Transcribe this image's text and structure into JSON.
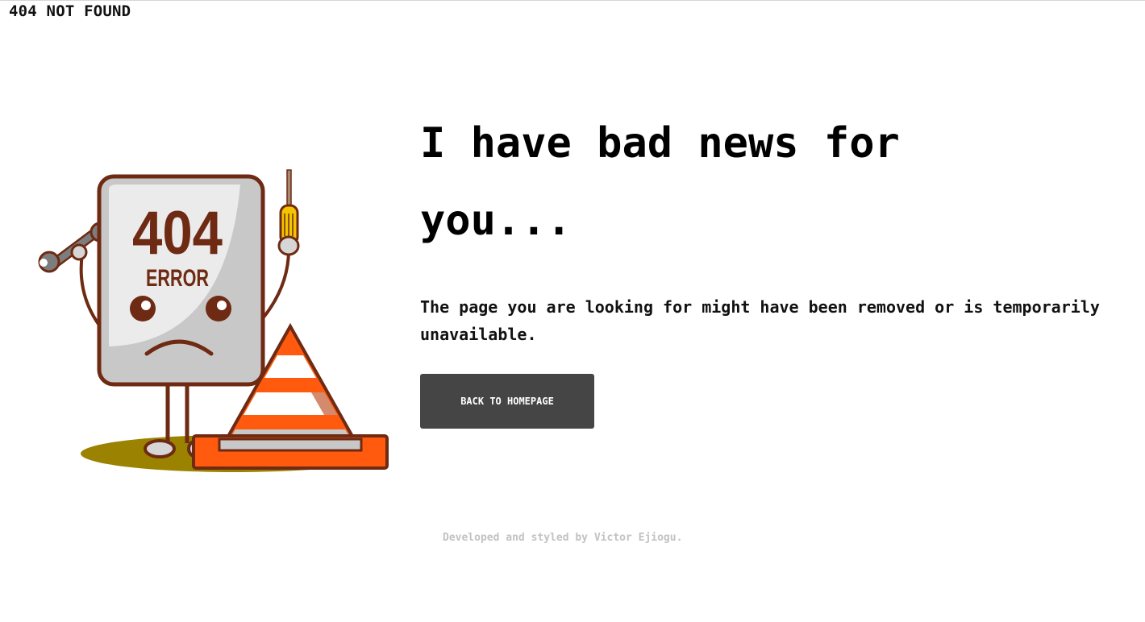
{
  "header": {
    "title": "404 NOT FOUND"
  },
  "illustration": {
    "code": "404",
    "label": "ERROR",
    "colors": {
      "outline": "#6e2a12",
      "card": "#c9c8c8",
      "card_highlight": "#ebebeb",
      "cone": "#ff5a0e",
      "cone_shadow": "#b83d0c",
      "stripe": "#c8c8c8",
      "ground_shadow": "#9b8200",
      "screwdriver_handle": "#f2c500",
      "tool": "#7d7d7d"
    }
  },
  "main": {
    "headline": "I have bad news for you...",
    "message": "The page you are looking for might have been removed or is temporarily unavailable.",
    "button_label": "BACK TO HOMEPAGE"
  },
  "footer": {
    "credit": "Developed and styled by Victor Ejiogu."
  },
  "colors": {
    "button_bg": "#454545",
    "button_text": "#ffffff",
    "credit_text": "#c2c2c2",
    "text": "#000000"
  }
}
